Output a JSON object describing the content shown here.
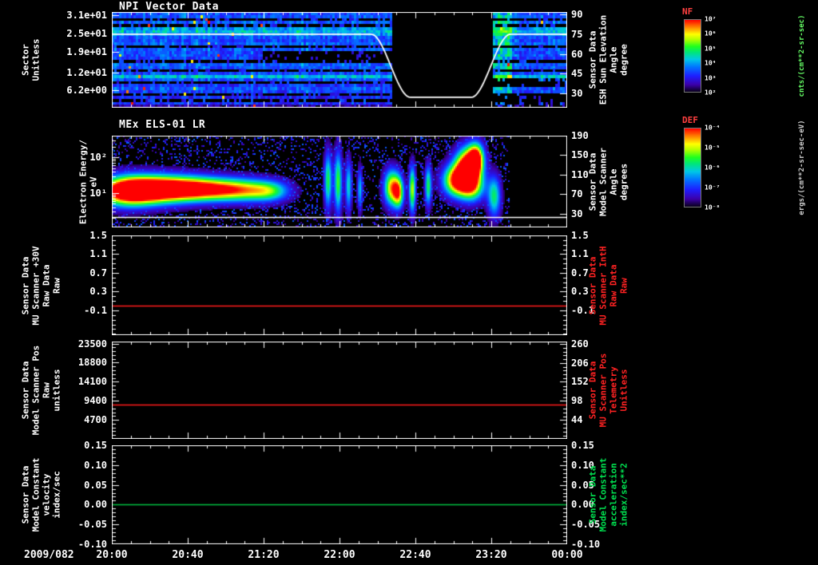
{
  "colors": {
    "background": "#000000",
    "axis_text": "#ffffff",
    "red_annotation": "#ff2222",
    "green_annotation": "#00e050"
  },
  "x_axis": {
    "date_label": "2009/082",
    "tick_labels": [
      "20:00",
      "20:40",
      "21:20",
      "22:00",
      "22:40",
      "23:20",
      "00:00"
    ]
  },
  "chart_data": [
    {
      "id": "npi",
      "type": "heatmap",
      "title": "NPI Vector Data",
      "time_start": "2009/082 20:00",
      "time_end": "2009/083 00:00",
      "left": {
        "label_lines": [
          "Sector",
          "Unitless"
        ],
        "scale": "linear",
        "range": [
          0.5,
          32
        ],
        "ticks": [
          31,
          25,
          19,
          12,
          6.2
        ],
        "tick_labels": [
          "3.1e+01",
          "2.5e+01",
          "1.9e+01",
          "1.2e+01",
          "6.2e+00"
        ]
      },
      "right": {
        "label_lines": [
          "Sensor Data",
          "ESH Sun Elevation",
          "Angle",
          "degree"
        ],
        "scale": "linear",
        "range": [
          19,
          92
        ],
        "ticks": [
          90,
          75,
          60,
          45,
          30
        ],
        "tick_labels": [
          "90",
          "75",
          "60",
          "45",
          "30"
        ]
      },
      "colorbar": {
        "title": "NF",
        "unit": "cnts/(cm**2-sr-sec)",
        "tick_labels": [
          "10⁷",
          "10⁶",
          "10⁵",
          "10⁴",
          "10³",
          "10²"
        ]
      },
      "content": "32 sector rows of mostly low (blue) neutral-particle count-rate noise; telemetry gap approx 22:28-23:20; brighter columns just after the gap; sparse high-count specks before approx 21:00",
      "rows": 32,
      "row_intensity": [
        0.28,
        0.3,
        0.05,
        0.32,
        0.05,
        0.4,
        0.45,
        0.38,
        0.3,
        0.28,
        0.32,
        0.05,
        0.3,
        0.28,
        0.3,
        0.26,
        0.05,
        0.32,
        0.3,
        0.05,
        0.28,
        0.45,
        0.3,
        0.05,
        0.25,
        0.3,
        0.28,
        0.05,
        0.22,
        0.05,
        0.25,
        0.1
      ],
      "gap_t": [
        0.615,
        0.835
      ],
      "dark_patch": {
        "rows": [
          13,
          15
        ],
        "t": [
          0.33,
          0.615
        ]
      },
      "overlay_line": {
        "name": "ESH Sun Elevation Angle",
        "color": "#ffffff",
        "points": [
          [
            0,
            75
          ],
          [
            0.57,
            75
          ],
          [
            0.655,
            27
          ],
          [
            0.79,
            27
          ],
          [
            0.875,
            75
          ],
          [
            1,
            75
          ]
        ]
      }
    },
    {
      "id": "els",
      "type": "heatmap",
      "title": "MEx ELS-01 LR",
      "left": {
        "label_lines": [
          "Electron Energy/",
          "eV"
        ],
        "scale": "log",
        "range": [
          1.1,
          400
        ],
        "ticks": [
          100,
          10
        ],
        "tick_labels": [
          "10²",
          "10¹"
        ]
      },
      "right": {
        "label_lines": [
          "Sensor Data",
          "Model Scanner",
          "Angle",
          "degrees"
        ],
        "scale": "linear",
        "range": [
          2,
          190
        ],
        "ticks": [
          190,
          150,
          110,
          70,
          30
        ],
        "tick_labels": [
          "190",
          "150",
          "110",
          "70",
          "30"
        ]
      },
      "colorbar": {
        "title": "DEF",
        "unit": "ergs/(cm**2-sr-sec-eV)",
        "tick_labels": [
          "10⁻⁴",
          "10⁻⁵",
          "10⁻⁶",
          "10⁻⁷",
          "10⁻⁸"
        ]
      },
      "content": "Intense 5-50 eV electron band fading from 20:00 to approx 21:20; sporadic vertical bursts 21:55-22:50; strongest burst reaching above 100 eV approx 22:55-23:15; no data after approx 23:30",
      "noise_density": 0.2,
      "data_end_t": 0.872,
      "blobs": [
        [
          0.03,
          0.045,
          1.05,
          0.28,
          1.05
        ],
        [
          0.09,
          0.05,
          1.1,
          0.26,
          0.95
        ],
        [
          0.16,
          0.05,
          1.12,
          0.24,
          0.8
        ],
        [
          0.23,
          0.05,
          1.1,
          0.22,
          0.68
        ],
        [
          0.3,
          0.045,
          1.08,
          0.22,
          0.55
        ],
        [
          0.35,
          0.03,
          1.05,
          0.2,
          0.4
        ],
        [
          0.475,
          0.006,
          1.35,
          0.55,
          0.6
        ],
        [
          0.497,
          0.006,
          1.3,
          0.6,
          0.65
        ],
        [
          0.52,
          0.005,
          1.2,
          0.5,
          0.5
        ],
        [
          0.545,
          0.004,
          1.1,
          0.4,
          0.45
        ],
        [
          0.615,
          0.012,
          1.15,
          0.35,
          0.85
        ],
        [
          0.63,
          0.008,
          1.0,
          0.3,
          0.7
        ],
        [
          0.66,
          0.005,
          1.1,
          0.45,
          0.75
        ],
        [
          0.695,
          0.005,
          1.2,
          0.4,
          0.6
        ],
        [
          0.755,
          0.02,
          1.35,
          0.3,
          0.9
        ],
        [
          0.78,
          0.018,
          1.75,
          0.35,
          1.1
        ],
        [
          0.8,
          0.012,
          1.95,
          0.3,
          1.0
        ],
        [
          0.79,
          0.02,
          1.2,
          0.3,
          0.8
        ],
        [
          0.84,
          0.01,
          0.9,
          0.4,
          0.55
        ]
      ],
      "overlay_line": {
        "name": "Model Scanner Angle",
        "color": "#ffffff",
        "value": 23
      }
    },
    {
      "id": "mu-scanner-30v",
      "type": "line",
      "left": {
        "label_lines": [
          "Sensor Data",
          "MU Scanner +30V",
          "Raw Data",
          "Raw"
        ],
        "scale": "linear",
        "range": [
          -0.63,
          1.5
        ],
        "ticks": [
          1.5,
          1.1,
          0.7,
          0.3,
          -0.1
        ],
        "tick_labels": [
          "1.5",
          "1.1",
          "0.7",
          "0.3",
          "-0.1"
        ]
      },
      "right": {
        "label_lines": [
          "Sensor Data",
          "MU Scanner IntH",
          "Raw Data",
          "Raw"
        ],
        "label_color": "#ff2222",
        "scale": "linear",
        "range": [
          -0.63,
          1.5
        ],
        "ticks": [
          1.5,
          1.1,
          0.7,
          0.3,
          -0.1
        ],
        "tick_labels": [
          "1.5",
          "1.1",
          "0.7",
          "0.3",
          "-0.1"
        ]
      },
      "yminor": 3,
      "series": [
        {
          "name": "MU Scanner +30V Raw",
          "color": "#ff1a1a",
          "value": 0.0
        }
      ]
    },
    {
      "id": "model-scanner-pos",
      "type": "line",
      "left": {
        "label_lines": [
          "Sensor Data",
          "Model Scanner Pos",
          "Raw",
          "unitless"
        ],
        "scale": "linear",
        "range": [
          0,
          24000
        ],
        "ticks": [
          23500,
          18800,
          14100,
          9400,
          4700
        ],
        "tick_labels": [
          "23500",
          "18800",
          "14100",
          "9400",
          "4700"
        ]
      },
      "right": {
        "label_lines": [
          "Sensor Data",
          "MU Scanner Pos",
          "Telemetry",
          "Unitless"
        ],
        "label_color": "#ff2222",
        "scale": "linear",
        "range": [
          -10,
          266
        ],
        "ticks": [
          260,
          206,
          152,
          98,
          44
        ],
        "tick_labels": [
          "260",
          "206",
          "152",
          "98",
          "44"
        ]
      },
      "yminor": 4,
      "series": [
        {
          "name": "Model Scanner Pos Raw",
          "color": "#ff1a1a",
          "value": 8500
        }
      ]
    },
    {
      "id": "model-constant",
      "type": "line",
      "left": {
        "label_lines": [
          "Sensor Data",
          "Model Constant",
          "velocity",
          "index/sec"
        ],
        "scale": "linear",
        "range": [
          -0.1,
          0.15
        ],
        "ticks": [
          0.15,
          0.1,
          0.05,
          0.0,
          -0.05,
          -0.1
        ],
        "tick_labels": [
          "0.15",
          "0.10",
          "0.05",
          "0.00",
          "-0.05",
          "-0.10"
        ]
      },
      "right": {
        "label_lines": [
          "Sensor Data",
          "Model Constant",
          "acceleration",
          "index/sec**2"
        ],
        "label_color": "#00e050",
        "scale": "linear",
        "range": [
          -0.1,
          0.15
        ],
        "ticks": [
          0.15,
          0.1,
          0.05,
          0.0,
          -0.05,
          -0.1
        ],
        "tick_labels": [
          "0.15",
          "0.10",
          "0.05",
          "0.00",
          "-0.05",
          "-0.10"
        ]
      },
      "yminor": 4,
      "series": [
        {
          "name": "Model Constant velocity",
          "color": "#00c040",
          "value": 0.0
        }
      ]
    }
  ]
}
